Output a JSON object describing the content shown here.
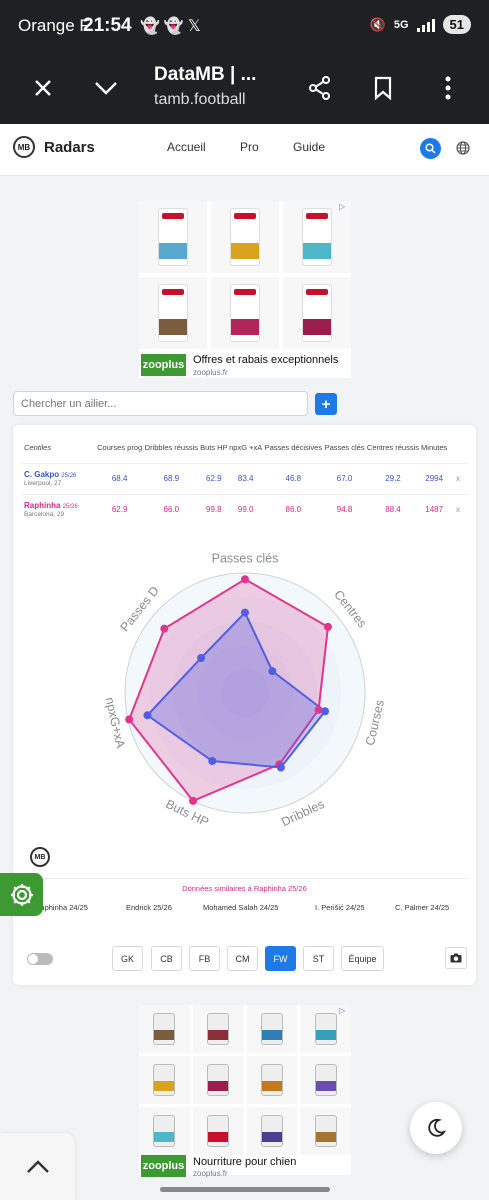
{
  "status_bar": {
    "carrier": "Orange F",
    "time": "21:54",
    "network": "5G",
    "battery": "51"
  },
  "browser": {
    "title": "DataMB | ...",
    "url": "tamb.football"
  },
  "header": {
    "site_title": "Radars",
    "logo_text": "MB",
    "nav": [
      "Accueil",
      "Pro",
      "Guide"
    ]
  },
  "ad_top": {
    "title": "Offres et rabais exceptionnels",
    "sub": "zooplus.fr",
    "brand": "zooplus"
  },
  "search": {
    "placeholder": "Chercher un ailier...",
    "add_label": "+"
  },
  "table": {
    "headers": [
      "Centiles",
      "Courses prog",
      "Dribbles réussis",
      "Buts HP",
      "npxG +xA",
      "Passes décisives",
      "Passes clés",
      "Centres réussis",
      "Minutes"
    ],
    "rows": [
      {
        "name": "C. Gakpo",
        "season": "25/26",
        "team": "Liverpool, 27",
        "values": [
          "68.4",
          "68.9",
          "62.9",
          "83.4",
          "46.8",
          "67.0",
          "29.2",
          "2994"
        ],
        "remove": "x",
        "color": "#3a52cf"
      },
      {
        "name": "Raphinha",
        "season": "25/26",
        "team": "Barcelona, 29",
        "values": [
          "62.9",
          "66.0",
          "99.8",
          "99.0",
          "86.0",
          "94.8",
          "88.4",
          "1487"
        ],
        "remove": "x",
        "color": "#d6288a"
      }
    ]
  },
  "chart_data": {
    "type": "radar",
    "axes": [
      "Passes clés",
      "Centres",
      "Courses",
      "Dribbles",
      "Buts HP",
      "npxG+xA",
      "Passes D"
    ],
    "range": [
      0,
      100
    ],
    "series": [
      {
        "name": "C. Gakpo 25/26",
        "color": "#4f5fe0",
        "values": [
          67.0,
          29.2,
          68.4,
          68.9,
          62.9,
          83.4,
          46.8
        ]
      },
      {
        "name": "Raphinha 25/26",
        "color": "#e0358e",
        "values": [
          94.8,
          88.4,
          62.9,
          66.0,
          99.8,
          99.0,
          86.0
        ]
      }
    ]
  },
  "similar": {
    "title": "Données similaires à Raphinha 25/26",
    "players": [
      "Raphinha 24/25",
      "Endrick 25/26",
      "Mohamed Salah 24/25",
      "I. Perišić 24/25",
      "C. Palmer 24/25"
    ]
  },
  "positions": {
    "buttons": [
      "GK",
      "CB",
      "FB",
      "CM",
      "FW",
      "ST",
      "Équipe"
    ],
    "active": "FW"
  },
  "ad_bottom": {
    "title": "Nourriture pour chien",
    "sub": "zooplus.fr",
    "brand": "zooplus"
  },
  "colors": {
    "accent": "#1e7be6",
    "player1": "#3a52cf",
    "player2": "#d6288a",
    "zooplus": "#3d9a32"
  },
  "icons": [
    "close-icon",
    "chevron-down-icon",
    "share-icon",
    "bookmark-icon",
    "more-icon",
    "search-icon",
    "globe-icon",
    "gear-icon",
    "camera-icon",
    "moon-icon",
    "chevron-up-icon"
  ]
}
